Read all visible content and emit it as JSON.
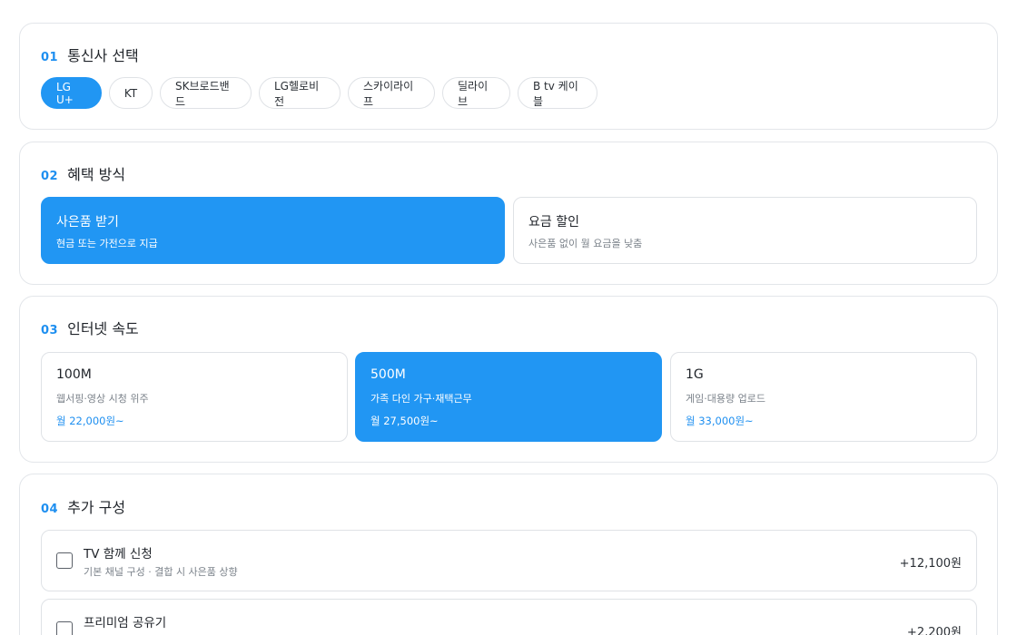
{
  "sections": [
    {
      "num": "01",
      "label": "통신사 선택"
    },
    {
      "num": "02",
      "label": "혜택 방식"
    },
    {
      "num": "03",
      "label": "인터넷 속도"
    },
    {
      "num": "04",
      "label": "추가 구성"
    }
  ],
  "carriers": [
    "LG U+",
    "KT",
    "SK브로드밴드",
    "LG헬로비전",
    "스카이라이프",
    "딜라이브",
    "B tv 케이블"
  ],
  "selected_carrier": "LG U+",
  "benefits": [
    {
      "title": "사은품 받기",
      "sub": "현금 또는 가전으로 지급",
      "selected": true
    },
    {
      "title": "요금 할인",
      "sub": "사은품 없이 월 요금을 낮춤",
      "selected": false
    }
  ],
  "speeds": [
    {
      "title": "100M",
      "sub": "웹서핑·영상 시청 위주",
      "price": "월 22,000원~",
      "selected": false
    },
    {
      "title": "500M",
      "sub": "가족 다인 가구·재택근무",
      "price": "월 27,500원~",
      "selected": true
    },
    {
      "title": "1G",
      "sub": "게임·대용량 업로드",
      "price": "월 33,000원~",
      "selected": false
    }
  ],
  "options": [
    {
      "title": "TV 함께 신청",
      "sub": "기본 채널 구성 · 결합 시 사은품 상향",
      "price": "+12,100원",
      "checked": false
    },
    {
      "title": "프리미엄 공유기",
      "sub": "",
      "price": "+2,200원",
      "checked": false
    }
  ],
  "colors": {
    "accent": "#2196f3",
    "border": "#dfe2e6",
    "muted": "#7b828a"
  }
}
